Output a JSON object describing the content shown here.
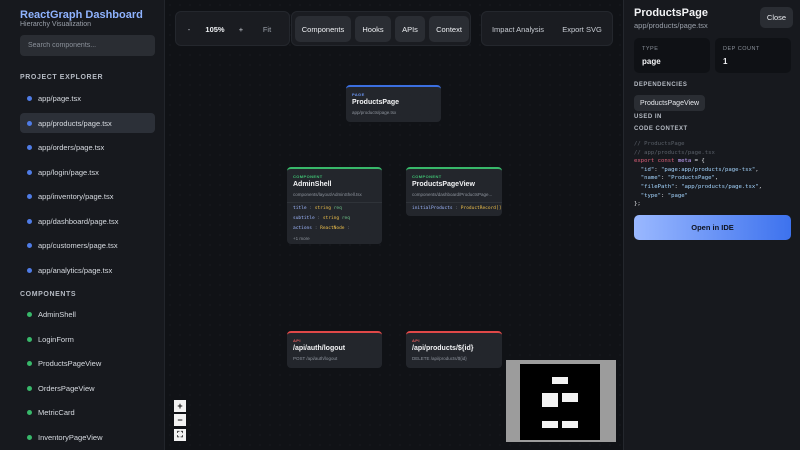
{
  "sidebar": {
    "brand": "ReactGraph Dashboard",
    "subtitle": "Hierarchy Visualization",
    "search_placeholder": "Search components...",
    "project_title": "PROJECT EXPLORER",
    "project_items": [
      {
        "label": "app/page.tsx",
        "active": false
      },
      {
        "label": "app/products/page.tsx",
        "active": true
      },
      {
        "label": "app/orders/page.tsx",
        "active": false
      },
      {
        "label": "app/login/page.tsx",
        "active": false
      },
      {
        "label": "app/inventory/page.tsx",
        "active": false
      },
      {
        "label": "app/dashboard/page.tsx",
        "active": false
      },
      {
        "label": "app/customers/page.tsx",
        "active": false
      },
      {
        "label": "app/analytics/page.tsx",
        "active": false
      }
    ],
    "components_title": "COMPONENTS",
    "component_items": [
      {
        "label": "AdminShell"
      },
      {
        "label": "LoginForm"
      },
      {
        "label": "ProductsPageView"
      },
      {
        "label": "OrdersPageView"
      },
      {
        "label": "MetricCard"
      },
      {
        "label": "InventoryPageView"
      }
    ]
  },
  "toolbar": {
    "zoom_out": "-",
    "zoom_level": "105%",
    "zoom_in": "+",
    "fit": "Fit",
    "filters": [
      "Components",
      "Hooks",
      "APIs",
      "Context"
    ],
    "impact": "Impact Analysis",
    "export": "Export SVG"
  },
  "nodes": {
    "page": {
      "kind": "PAGE",
      "title": "ProductsPage",
      "path": "app/products/page.tsx"
    },
    "admin": {
      "kind": "COMPONENT",
      "title": "AdminShell",
      "path": "components/layout/AdminShell.tsx",
      "props": [
        {
          "name": "title",
          "type": "string",
          "opt": "req"
        },
        {
          "name": "subtitle",
          "type": "string",
          "opt": "req"
        },
        {
          "name": "actions",
          "type": "ReactNode",
          "opt": ""
        }
      ],
      "more": "+1 more"
    },
    "ppv": {
      "kind": "COMPONENT",
      "title": "ProductsPageView",
      "path": "components/dashboard/ProductsPage...",
      "props": [
        {
          "name": "initialProducts",
          "type": "ProductRecord[]"
        }
      ]
    },
    "logout": {
      "kind": "API",
      "title": "/api/auth/logout",
      "path": "POST /api/auth/logout"
    },
    "products_api": {
      "kind": "API",
      "title": "/api/products/${id}",
      "path": "DELETE /api/products/${id}"
    }
  },
  "zoom_controls": {
    "plus": "+",
    "minus": "−",
    "fit": "⛶"
  },
  "panel": {
    "title": "ProductsPage",
    "subtitle": "app/products/page.tsx",
    "close": "Close",
    "type_label": "TYPE",
    "type_value": "page",
    "dep_label": "DEP COUNT",
    "dep_value": "1",
    "dependencies_title": "DEPENDENCIES",
    "dependency": "ProductsPageView",
    "used_in_title": "USED IN",
    "code_title": "CODE CONTEXT",
    "code": {
      "c1": "// ProductsPage",
      "c2": "// app/products/page.tsx",
      "kw_export": "export",
      "kw_const": "const",
      "meta": "meta",
      "id_key": "\"id\"",
      "id_val": "\"page:app/products/page-tsx\"",
      "name_key": "\"name\"",
      "name_val": "\"ProductsPage\"",
      "fp_key": "\"filePath\"",
      "fp_val": "\"app/products/page.tsx\"",
      "type_key": "\"type\"",
      "type_val": "\"page\""
    },
    "ide_button": "Open in IDE"
  }
}
